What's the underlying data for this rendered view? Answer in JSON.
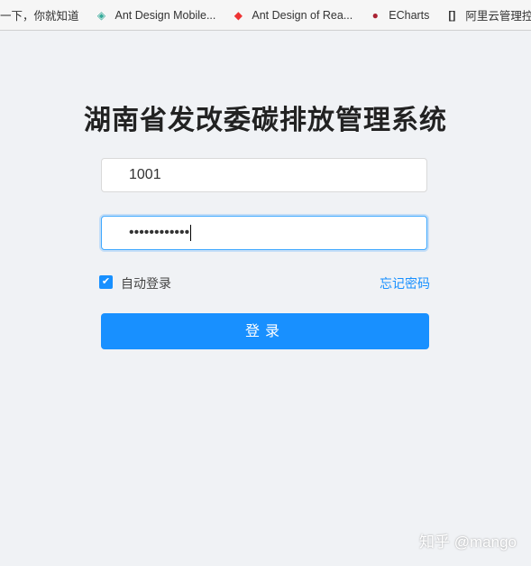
{
  "bookmarks": [
    {
      "label": "一下，你就知道",
      "icon": "none"
    },
    {
      "label": "Ant Design Mobile...",
      "icon": "ant-mobile-icon"
    },
    {
      "label": "Ant Design of Rea...",
      "icon": "ant-design-icon"
    },
    {
      "label": "ECharts",
      "icon": "echarts-icon"
    },
    {
      "label": "阿里云管理控制",
      "icon": "aliyun-icon"
    }
  ],
  "title": "湖南省发改委碳排放管理系统",
  "username": "1001",
  "password_masked": "••••••••••••",
  "remember": {
    "label": "自动登录",
    "checked": true
  },
  "forgot": "忘记密码",
  "login": "登录",
  "watermark": "知乎 @mango",
  "colors": {
    "primary": "#1890ff",
    "background": "#f0f2f5"
  }
}
